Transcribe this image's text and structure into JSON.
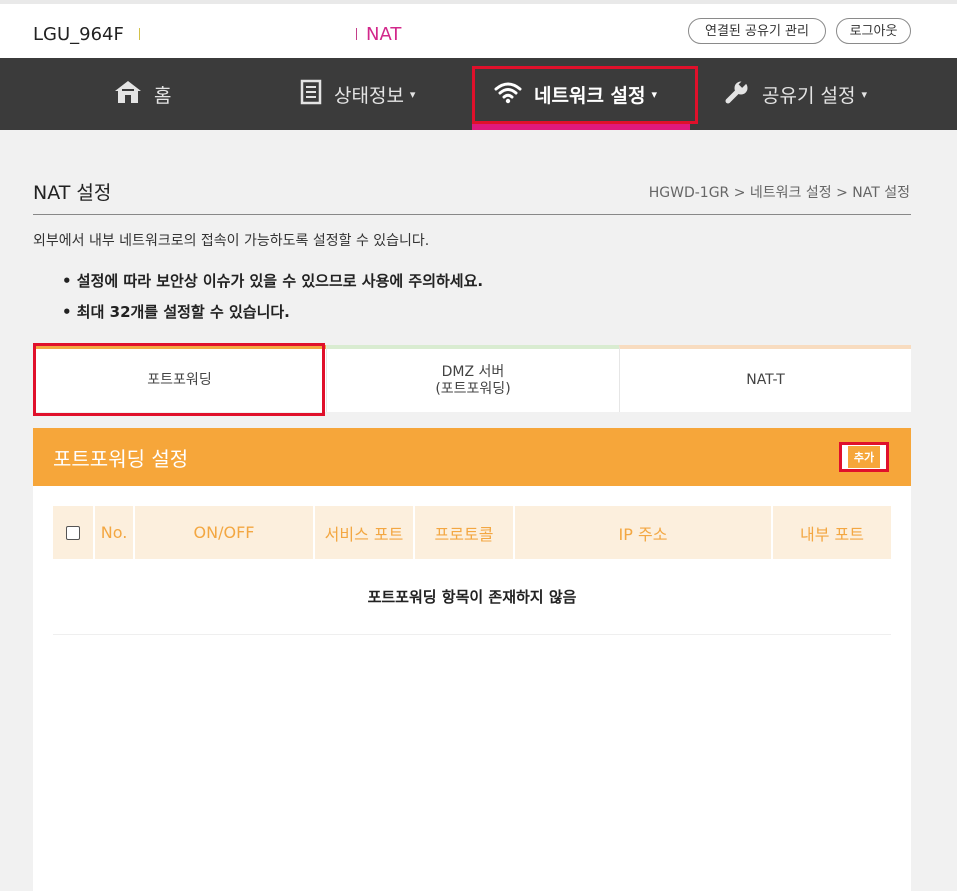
{
  "header": {
    "ssid": "LGU_964F",
    "mode": "NAT",
    "manage_button": "연결된 공유기 관리",
    "logout_button": "로그아웃"
  },
  "nav": {
    "home": "홈",
    "status": "상태정보",
    "network": "네트워크 설정",
    "router": "공유기 설정",
    "caret": "▾"
  },
  "page": {
    "title": "NAT 설정",
    "breadcrumb": "HGWD-1GR > 네트워크 설정 > NAT 설정",
    "description": "외부에서 내부 네트워크로의 접속이 가능하도록 설정할 수 있습니다.",
    "notes": [
      "• 설정에 따라 보안상 이슈가 있을 수 있으므로 사용에 주의하세요.",
      "• 최대 32개를 설정할 수 있습니다."
    ]
  },
  "tabs": [
    {
      "label": "포트포워딩"
    },
    {
      "label": "DMZ 서버\n(포트포워딩)"
    },
    {
      "label": "NAT-T"
    }
  ],
  "panel": {
    "title": "포트포워딩 설정",
    "add_button": "추가",
    "columns": [
      "No.",
      "ON/OFF",
      "서비스 포트",
      "프로토콜",
      "IP 주소",
      "내부 포트"
    ],
    "empty_message": "포트포워딩 항목이 존재하지 않음"
  },
  "colors": {
    "accent_orange": "#f6a63a",
    "nav_bg": "#3b3b3b",
    "highlight_red": "#e0102b",
    "active_pink": "#e0197d"
  }
}
